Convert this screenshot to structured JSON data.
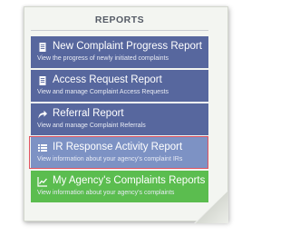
{
  "panel": {
    "title": "REPORTS"
  },
  "reports": [
    {
      "title": "New Complaint Progress Report",
      "description": "View the progress of newly initiated complaints",
      "icon": "document-icon"
    },
    {
      "title": "Access Request Report",
      "description": "View and manage Complaint Access Requests",
      "icon": "document-icon"
    },
    {
      "title": "Referral Report",
      "description": "View and manage Complaint Referrals",
      "icon": "share-arrow-icon"
    },
    {
      "title": "IR Response Activity Report",
      "description": "View information about your agency's complaint IRs",
      "icon": "list-icon"
    },
    {
      "title": "My Agency's Complaints Reports",
      "description": "View information about your agency's complaints",
      "icon": "line-chart-icon"
    }
  ],
  "colors": {
    "item": "#57679e",
    "selected": "#7d92c4",
    "green": "#5bbd4f",
    "highlight": "#e0535f"
  }
}
